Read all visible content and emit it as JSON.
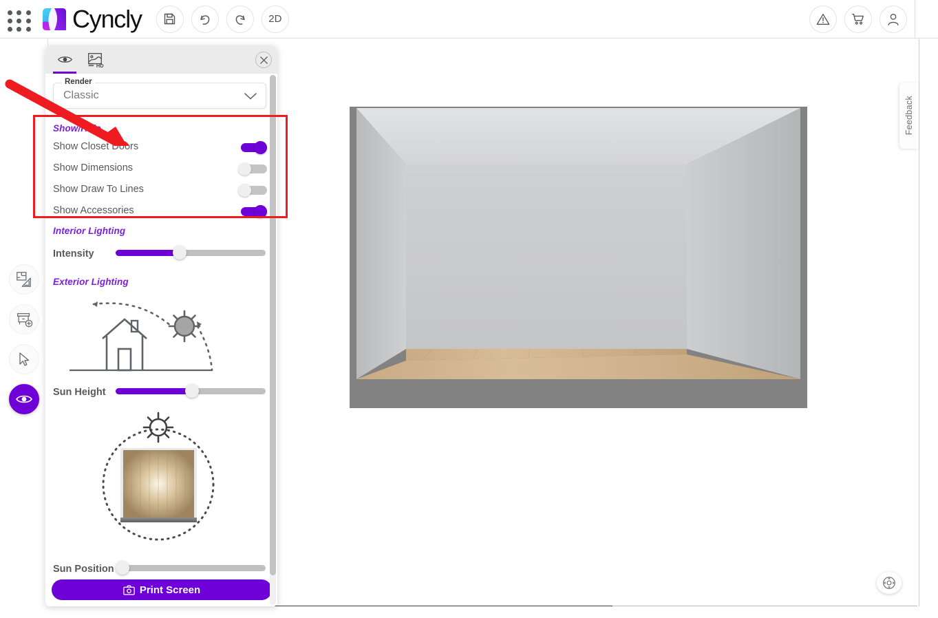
{
  "app": {
    "brand_name": "Cyncly",
    "accent": "#6e00d8",
    "annotation_color": "#ee1b21"
  },
  "topbar": {
    "apps_icon": "waffle-grid-icon",
    "logo_icon": "cyncly-logo-icon",
    "buttons": [
      {
        "name": "save-button",
        "icon": "floppy-disk-icon",
        "label": ""
      },
      {
        "name": "undo-button",
        "icon": "undo-arrow-icon",
        "label": ""
      },
      {
        "name": "redo-button",
        "icon": "redo-arrow-icon",
        "label": ""
      },
      {
        "name": "view-mode-button",
        "icon": "",
        "label": "2D"
      }
    ],
    "right_buttons": [
      {
        "name": "alerts-button",
        "icon": "warning-triangle-icon"
      },
      {
        "name": "cart-button",
        "icon": "shopping-cart-icon"
      },
      {
        "name": "account-button",
        "icon": "user-avatar-icon"
      }
    ]
  },
  "rail": {
    "items": [
      {
        "name": "sidebar-item-floorplan",
        "icon": "floorplan-ruler-icon",
        "active": false
      },
      {
        "name": "sidebar-item-add-cabinet",
        "icon": "cabinet-add-icon",
        "active": false
      },
      {
        "name": "sidebar-item-select",
        "icon": "cursor-arrow-icon",
        "active": false
      },
      {
        "name": "sidebar-item-view",
        "icon": "eye-icon",
        "active": true
      }
    ]
  },
  "panel": {
    "tabs": [
      {
        "name": "tab-view-settings",
        "icon": "eye-icon",
        "active": true
      },
      {
        "name": "tab-hd-render",
        "icon": "hd-image-icon",
        "active": false
      }
    ],
    "close_icon": "close-icon",
    "render": {
      "legend": "Render",
      "value": "Classic",
      "chevron_icon": "chevron-down-icon",
      "options": [
        "Classic"
      ]
    },
    "show_hide": {
      "title": "Show/Hide",
      "rows": [
        {
          "label": "Show Closet Doors",
          "on": true
        },
        {
          "label": "Show Dimensions",
          "on": false
        },
        {
          "label": "Show Draw To Lines",
          "on": false
        },
        {
          "label": "Show Accessories",
          "on": true
        }
      ]
    },
    "interior_lighting": {
      "title": "Interior Lighting",
      "intensity": {
        "label": "Intensity",
        "percent": 42
      }
    },
    "exterior_lighting": {
      "title": "Exterior Lighting",
      "sun_height_graphic": "house-sun-arc-icon",
      "sun_height": {
        "label": "Sun Height",
        "percent": 51
      },
      "sun_position_graphic": "sun-orbit-room-icon",
      "sun_position": {
        "label": "Sun Position",
        "percent": 0
      }
    },
    "print_screen": {
      "label": "Print Screen",
      "icon": "camera-icon"
    }
  },
  "canvas": {
    "nav_widget": {
      "name": "pan-navigate-widget",
      "icon": "four-arrows-icon"
    },
    "room": {
      "wall_color": "#c9cacb",
      "ceiling_color": "#dcdddf",
      "floor_color": "#c6a882",
      "thickness_color": "#828282"
    }
  },
  "feedback_tab": {
    "label": "Feedback"
  }
}
